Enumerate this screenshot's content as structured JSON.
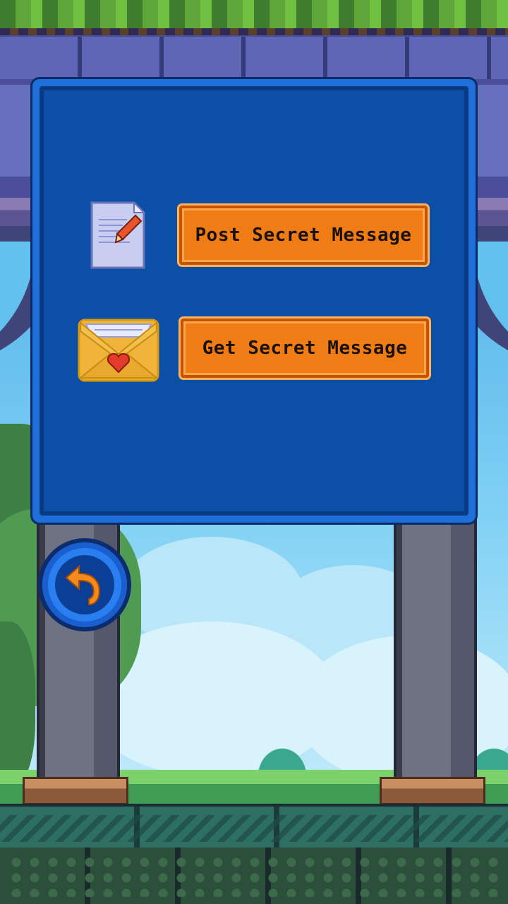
{
  "menu": {
    "post_button_label": "Post Secret Message",
    "get_button_label": "Get Secret Message"
  },
  "icons": {
    "post": "document-pencil-icon",
    "get": "envelope-heart-icon",
    "back": "undo-arrow-icon"
  },
  "colors": {
    "button_fill": "#f07c16",
    "button_border": "#c65300",
    "panel_fill": "#0c4fa6",
    "panel_frame": "#1e6fd9",
    "back_button": "#2a7ff0",
    "back_arrow": "#f58a1f"
  }
}
